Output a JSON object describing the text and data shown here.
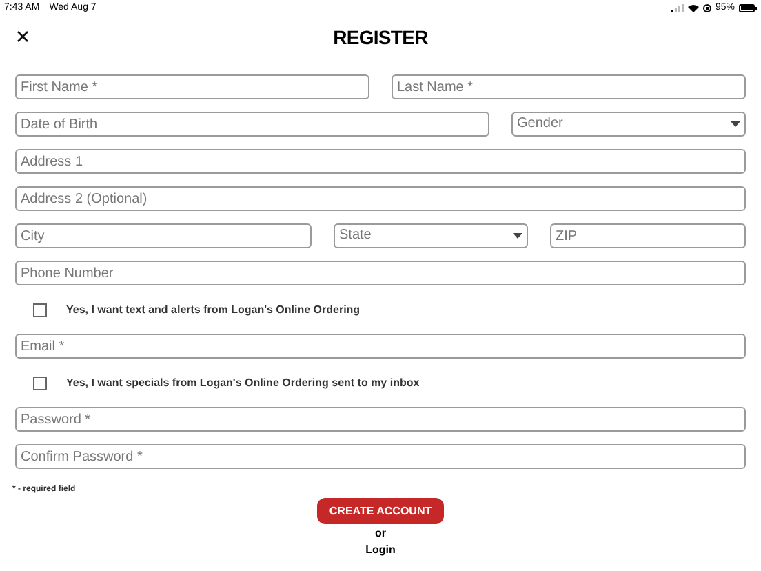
{
  "status_bar": {
    "time": "7:43 AM",
    "date": "Wed Aug 7",
    "battery": "95%"
  },
  "header": {
    "title": "REGISTER"
  },
  "form_rows": [
    {
      "kind": "fields",
      "fields": [
        {
          "kind": "input",
          "placeholder": "First Name *"
        },
        {
          "kind": "input",
          "placeholder": "Last Name *"
        }
      ]
    },
    {
      "kind": "fields",
      "fields": [
        {
          "kind": "input",
          "placeholder": "Date of Birth"
        },
        {
          "kind": "select",
          "placeholder": "Gender"
        }
      ]
    },
    {
      "kind": "fields",
      "fields": [
        {
          "kind": "input",
          "placeholder": "Address 1"
        }
      ]
    },
    {
      "kind": "fields",
      "fields": [
        {
          "kind": "input",
          "placeholder": "Address 2 (Optional)"
        }
      ]
    },
    {
      "kind": "fields",
      "fields": [
        {
          "kind": "input",
          "placeholder": "City"
        },
        {
          "kind": "select",
          "placeholder": "State"
        },
        {
          "kind": "input",
          "placeholder": "ZIP"
        }
      ]
    },
    {
      "kind": "fields",
      "fields": [
        {
          "kind": "input",
          "placeholder": "Phone Number"
        }
      ]
    },
    {
      "kind": "checkbox",
      "label": "Yes, I want text and alerts from Logan's Online Ordering",
      "checked": false
    },
    {
      "kind": "fields",
      "fields": [
        {
          "kind": "input",
          "placeholder": "Email *"
        }
      ]
    },
    {
      "kind": "checkbox",
      "label": "Yes, I want specials from Logan's Online Ordering sent to my inbox",
      "checked": false
    },
    {
      "kind": "fields",
      "fields": [
        {
          "kind": "input",
          "placeholder": "Password *"
        }
      ]
    },
    {
      "kind": "fields",
      "fields": [
        {
          "kind": "input",
          "placeholder": "Confirm Password *"
        }
      ]
    }
  ],
  "required_note": "* - required field",
  "create_button": "CREATE ACCOUNT",
  "or_text": "or",
  "login_link": "Login"
}
